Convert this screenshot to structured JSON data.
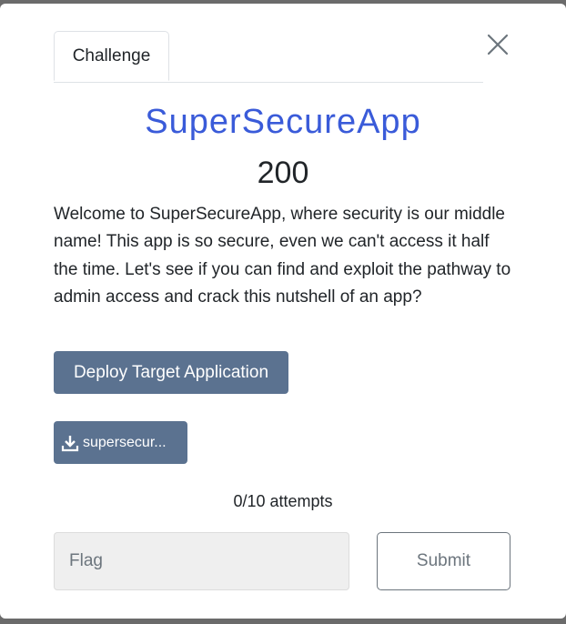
{
  "modal": {
    "tabs": [
      {
        "label": "Challenge"
      }
    ],
    "close_icon": "close-icon"
  },
  "challenge": {
    "name": "SuperSecureApp",
    "points": "200",
    "description": "Welcome to SuperSecureApp, where security is our middle name! This app is so secure, even we can't access it half the time. Let's see if you can find and exploit the pathway to admin access and crack this nutshell of an app?",
    "deploy_label": "Deploy Target Application",
    "file": {
      "icon": "download-icon",
      "label": "supersecur..."
    },
    "attempts": "0/10 attempts"
  },
  "form": {
    "flag_placeholder": "Flag",
    "flag_value": "",
    "submit_label": "Submit"
  },
  "colors": {
    "title": "#3a5bd9",
    "button_bg": "#5b7290",
    "input_bg": "#efefef",
    "overlay": "#6b6b6b"
  }
}
